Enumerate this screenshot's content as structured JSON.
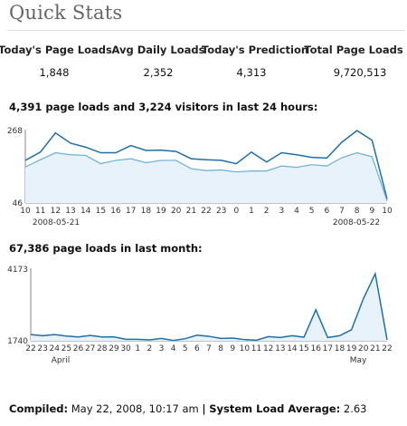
{
  "page": {
    "title": "Quick Stats"
  },
  "stats": [
    {
      "label": "Today's Page Loads",
      "value": "1,848"
    },
    {
      "label": "Avg Daily Loads",
      "value": "2,352"
    },
    {
      "label": "Today's Prediction",
      "value": "4,313"
    },
    {
      "label": "Total Page Loads",
      "value": "9,720,513"
    }
  ],
  "hourly": {
    "label": "4,391 page loads and 3,224 visitors in last 24 hours:",
    "date_start": "2008-05-21",
    "date_end": "2008-05-22"
  },
  "monthly": {
    "label": "67,386 page loads in last month:",
    "month_start": "April",
    "month_end": "May"
  },
  "footer": {
    "compiled_label": "Compiled:",
    "compiled_value": "May 22, 2008, 10:17 am",
    "separator": "|",
    "load_label": "System Load Average:",
    "load_value": "2.63"
  },
  "colors": {
    "line_dark": "#1f6fa8",
    "line_light": "#6aaedb",
    "fill_light": "#e8f2fa",
    "axis": "#888888"
  },
  "chart_data": [
    {
      "type": "area",
      "title": "4,391 page loads and 3,224 visitors in last 24 hours:",
      "ylim": [
        46,
        268
      ],
      "yticks": [
        "46",
        "268"
      ],
      "categories": [
        "10",
        "11",
        "12",
        "13",
        "14",
        "15",
        "16",
        "17",
        "18",
        "19",
        "20",
        "21",
        "22",
        "23",
        "0",
        "1",
        "2",
        "3",
        "4",
        "5",
        "6",
        "7",
        "8",
        "9",
        "10"
      ],
      "date_labels": [
        "2008-05-21",
        "2008-05-22"
      ],
      "series": [
        {
          "values": [
            175,
            200,
            258,
            227,
            215,
            198,
            198,
            220,
            205,
            206,
            202,
            180,
            177,
            175,
            165,
            200,
            170,
            198,
            192,
            184,
            182,
            230,
            265,
            236,
            58
          ]
        },
        {
          "values": [
            155,
            177,
            198,
            192,
            190,
            165,
            175,
            180,
            168,
            175,
            175,
            150,
            144,
            146,
            140,
            143,
            143,
            158,
            154,
            162,
            158,
            183,
            198,
            186,
            52
          ]
        }
      ],
      "grid": false
    },
    {
      "type": "area",
      "title": "67,386 page loads in last month:",
      "ylim": [
        1740,
        4173
      ],
      "yticks": [
        "1740",
        "4173"
      ],
      "categories": [
        "22",
        "23",
        "24",
        "25",
        "26",
        "27",
        "28",
        "29",
        "30",
        "1",
        "2",
        "3",
        "4",
        "5",
        "6",
        "7",
        "8",
        "9",
        "10",
        "11",
        "12",
        "13",
        "14",
        "15",
        "16",
        "17",
        "18",
        "19",
        "20",
        "21",
        "22"
      ],
      "month_labels": [
        "April",
        "May"
      ],
      "series": [
        {
          "values": [
            1950,
            1910,
            1950,
            1900,
            1870,
            1920,
            1870,
            1870,
            1790,
            1790,
            1770,
            1820,
            1750,
            1810,
            1930,
            1890,
            1820,
            1830,
            1780,
            1760,
            1880,
            1850,
            1910,
            1860,
            2780,
            1850,
            1910,
            2110,
            3150,
            3990,
            1770
          ]
        }
      ],
      "grid": false
    }
  ]
}
